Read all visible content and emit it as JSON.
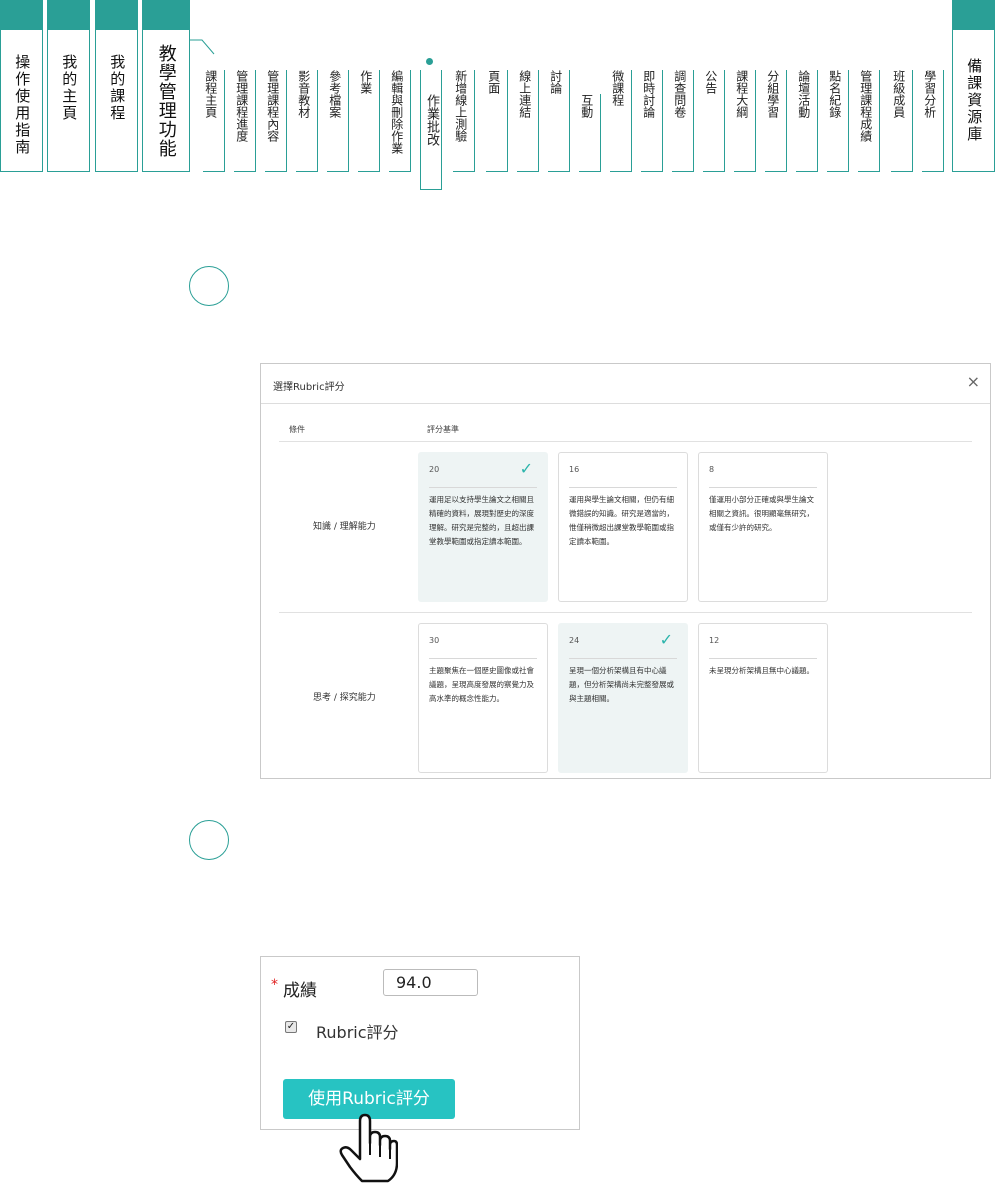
{
  "nav": {
    "big_tabs": [
      {
        "label": "操作使用指南"
      },
      {
        "label": "我的主頁"
      },
      {
        "label": "我的課程"
      },
      {
        "label": "教學管理功能"
      }
    ],
    "small_tabs": [
      {
        "label": "課程主頁"
      },
      {
        "label": "管理課程進度"
      },
      {
        "label": "管理課程內容"
      },
      {
        "label": "影音教材"
      },
      {
        "label": "參考檔案"
      },
      {
        "label": "作業"
      },
      {
        "label": "編輯與刪除作業"
      },
      {
        "label": "作業批改"
      },
      {
        "label": "新增線上測驗"
      },
      {
        "label": "頁面"
      },
      {
        "label": "線上連結"
      },
      {
        "label": "討論"
      },
      {
        "label": "互動"
      },
      {
        "label": "微課程"
      },
      {
        "label": "即時討論"
      },
      {
        "label": "調查問卷"
      },
      {
        "label": "公告"
      },
      {
        "label": "課程大綱"
      },
      {
        "label": "分組學習"
      },
      {
        "label": "論壇活動"
      },
      {
        "label": "點名紀錄"
      },
      {
        "label": "管理課程成績"
      },
      {
        "label": "班級成員"
      },
      {
        "label": "學習分析"
      }
    ],
    "right_tab": {
      "label": "備課資源庫"
    },
    "active_small_tab": "作業批改"
  },
  "dialog": {
    "title": "選擇Rubric評分",
    "close": "×",
    "col_condition": "條件",
    "col_criteria": "評分基準",
    "rows": [
      {
        "label": "知識 / 理解能力",
        "cards": [
          {
            "score": "20",
            "selected": true,
            "desc": "運用足以支持學生論文之相關且精確的資料，展現對歷史的深度理解。研究是完整的，且超出課堂教學範圍或指定讀本範圍。"
          },
          {
            "score": "16",
            "selected": false,
            "desc": "運用與學生論文相關，但仍有細微錯誤的知識。研究是適當的，惟僅稍微超出課堂教學範圍或指定讀本範圍。"
          },
          {
            "score": "8",
            "selected": false,
            "desc": "僅運用小部分正確或與學生論文相關之資訊。很明顯毫無研究，或僅有少許的研究。"
          }
        ]
      },
      {
        "label": "思考 / 探究能力",
        "cards": [
          {
            "score": "30",
            "selected": false,
            "desc": "主題聚焦在一個歷史圖像或社會議題，呈現高度發展的察覺力及高水準的概念性能力。"
          },
          {
            "score": "24",
            "selected": true,
            "desc": "呈現一個分析架構且有中心議題，但分析架構尚未完整發展或與主題相關。"
          },
          {
            "score": "12",
            "selected": false,
            "desc": "未呈現分析架構且無中心議題。"
          }
        ]
      }
    ]
  },
  "grade": {
    "required_mark": "*",
    "label": "成績",
    "value": "94.0",
    "rubric_checkbox_label": "Rubric評分",
    "rubric_checked": true,
    "button_label": "使用Rubric評分"
  },
  "colors": {
    "accent": "#2a9f96",
    "button": "#27c3c2",
    "selected_card": "#eef4f4",
    "check": "#2bb4ab"
  }
}
